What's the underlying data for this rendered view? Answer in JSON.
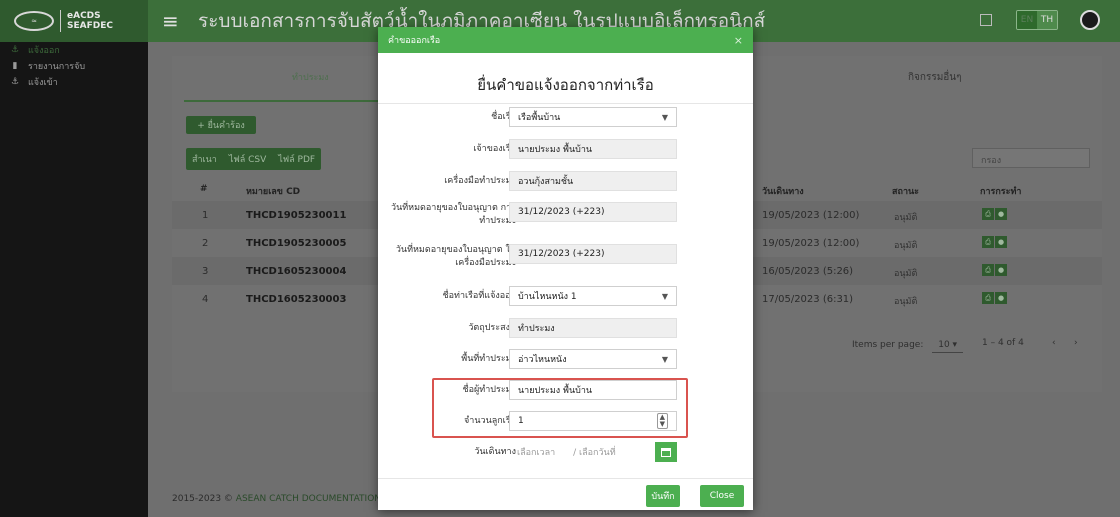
{
  "header": {
    "logo_line1": "eACDS",
    "logo_line2": "SEAFDEC",
    "title": "ระบบเอกสารการจับสัตว์น้ำในภูมิภาคอาเซียน ในรูปแบบอิเล็กทรอนิกส์",
    "lang_en": "EN",
    "lang_th": "TH"
  },
  "sidebar": {
    "items": [
      {
        "label": "แจ้งออก",
        "icon": "anchor-icon"
      },
      {
        "label": "รายงานการจับ",
        "icon": "document-icon"
      },
      {
        "label": "แจ้งเข้า",
        "icon": "anchor-icon"
      }
    ]
  },
  "content": {
    "tab_left": "ทำประมง",
    "tab_right": "กิจกรรมอื่นๆ",
    "add_button": "+ ยื่นคำร้อง",
    "export": [
      "สำเนา",
      "ไฟล์ CSV",
      "ไฟล์ PDF"
    ],
    "search_placeholder": "กรอง",
    "columns": {
      "num": "#",
      "cd": "หมายเลข CD",
      "depart": "วันเดินทาง",
      "status": "สถานะ",
      "action": "การกระทำ"
    },
    "rows": [
      {
        "num": "1",
        "cd": "THCD1905230011",
        "depart": "19/05/2023 (12:00)",
        "status": "อนุมัติ"
      },
      {
        "num": "2",
        "cd": "THCD1905230005",
        "depart": "19/05/2023 (12:00)",
        "status": "อนุมัติ"
      },
      {
        "num": "3",
        "cd": "THCD1605230004",
        "depart": "16/05/2023 (5:26)",
        "status": "อนุมัติ"
      },
      {
        "num": "4",
        "cd": "THCD1605230003",
        "depart": "17/05/2023 (6:31)",
        "status": "อนุมัติ"
      }
    ],
    "items_per_page_label": "Items per page:",
    "items_per_page": "10",
    "range": "1 – 4 of 4"
  },
  "footer": {
    "prefix": "2015-2023 © ",
    "link": "ASEAN CATCH DOCUMENTATION S"
  },
  "modal": {
    "header_title": "คำขอออกเรือ",
    "title": "ยื่นคำขอแจ้งออกจากท่าเรือ",
    "fields": {
      "boat_name_label": "ชื่อเรือ",
      "boat_name_value": "เรือพื้นบ้าน",
      "owner_label": "เจ้าของเรือ",
      "owner_value": "นายประมง พื้นบ้าน",
      "gear_label": "เครื่องมือทำประมง",
      "gear_value": "อวนกุ้งสามชั้น",
      "license_exp_label": "วันที่หมดอายุของใบอนุญาต การทำประมง",
      "license_exp_value": "31/12/2023 (+223)",
      "gear_license_exp_label": "วันที่หมดอายุของใบอนุญาต ใช้เครื่องมือประมง",
      "gear_license_exp_value": "31/12/2023 (+223)",
      "port_label": "ชื่อท่าเรือที่แจ้งออก",
      "port_value": "บ้านไหนหนัง 1",
      "purpose_label": "วัตถุประสงค์",
      "purpose_value": "ทำประมง",
      "area_label": "พื้นที่ทำประมง",
      "area_value": "อ่าวไหนหนัง",
      "fisher_label": "ชื่อผู้ทำประมง",
      "fisher_value": "นายประมง พื้นบ้าน",
      "crew_label": "จำนวนลูกเรือ",
      "crew_value": "1",
      "depart_label": "วันเดินทาง",
      "time_placeholder": "เลือกเวลา",
      "date_placeholder": "/ เลือกวันที่"
    },
    "save_button": "บันทึก",
    "close_button": "Close"
  }
}
